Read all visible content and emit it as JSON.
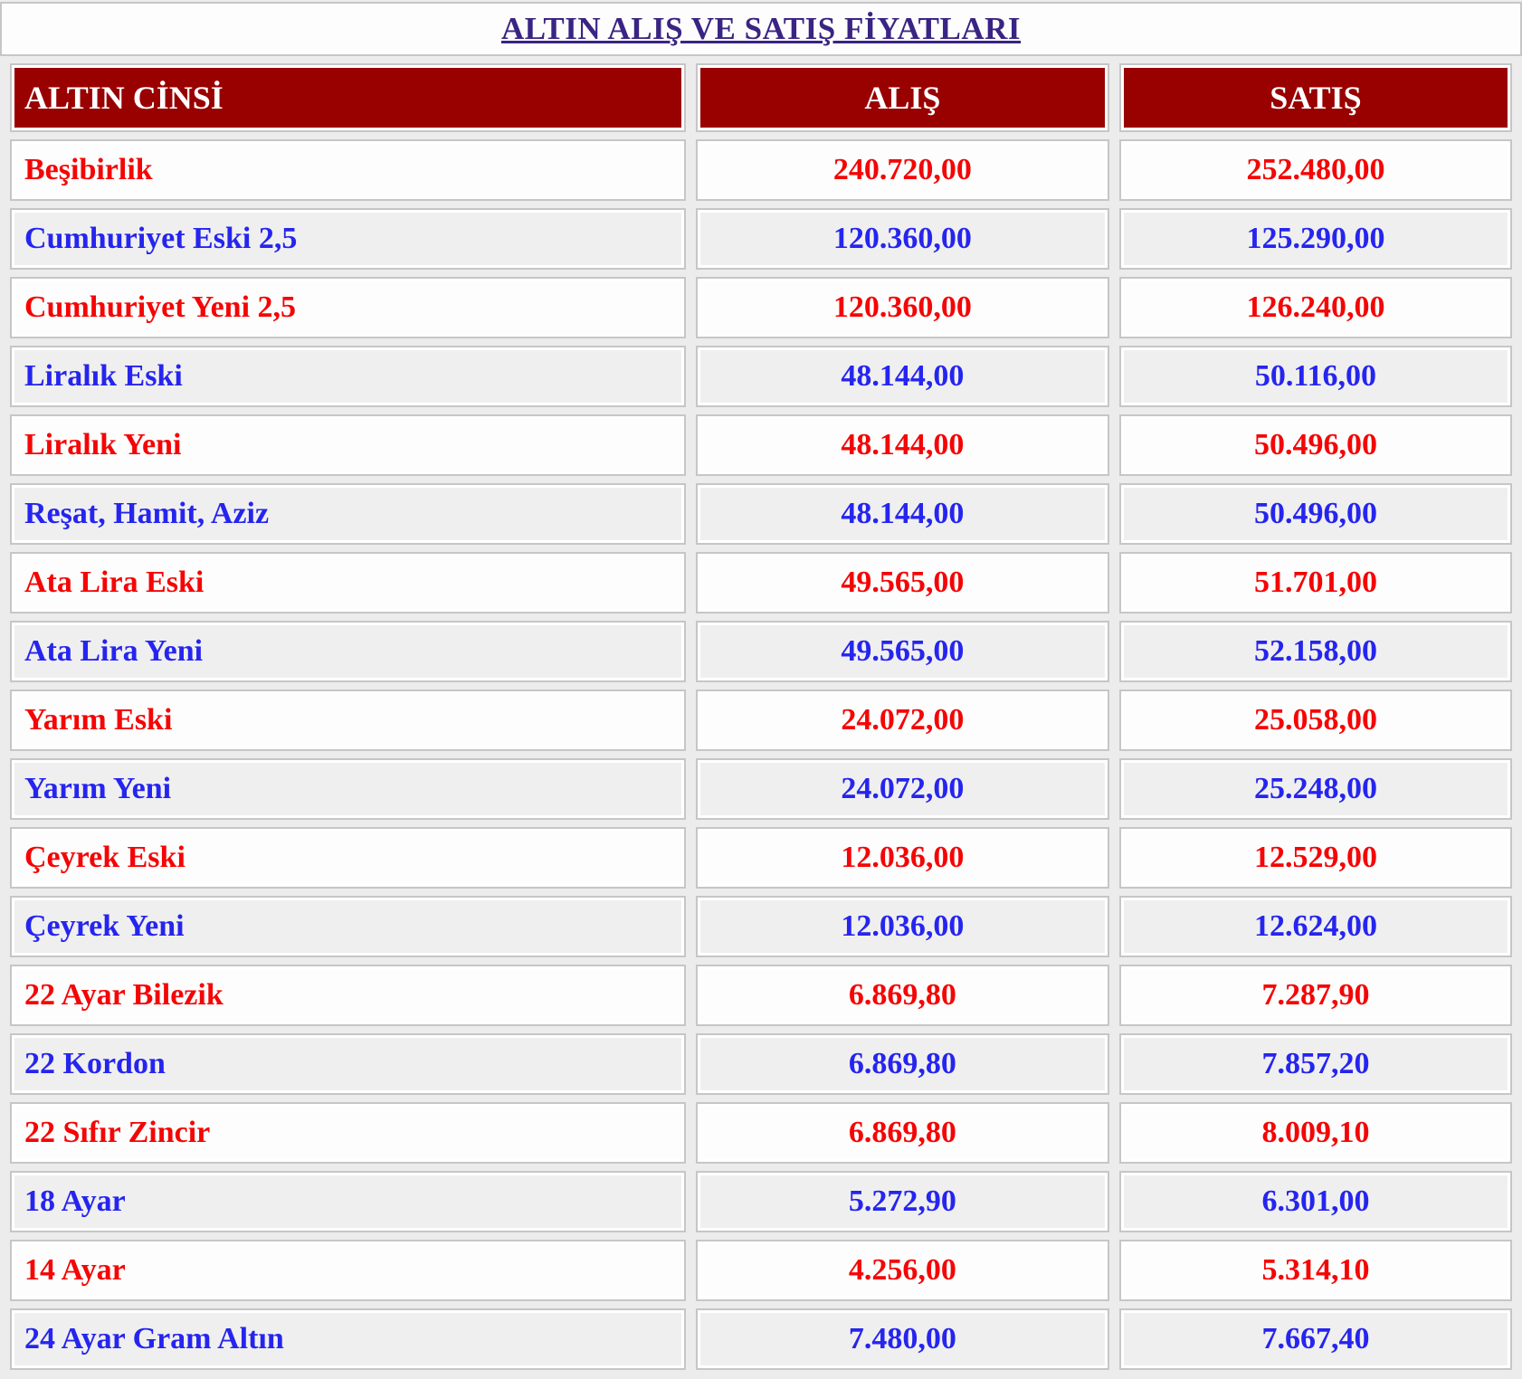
{
  "title": "ALTIN ALIŞ VE SATIŞ FİYATLARI",
  "table": {
    "headers": [
      "ALTIN CİNSİ",
      "ALIŞ",
      "SATIŞ"
    ],
    "rows": [
      {
        "name": "Beşibirlik",
        "buy": "240.720,00",
        "sell": "252.480,00",
        "color": "red"
      },
      {
        "name": "Cumhuriyet Eski 2,5",
        "buy": "120.360,00",
        "sell": "125.290,00",
        "color": "blue"
      },
      {
        "name": "Cumhuriyet Yeni 2,5",
        "buy": "120.360,00",
        "sell": "126.240,00",
        "color": "red"
      },
      {
        "name": "Liralık Eski",
        "buy": "48.144,00",
        "sell": "50.116,00",
        "color": "blue"
      },
      {
        "name": "Liralık Yeni",
        "buy": "48.144,00",
        "sell": "50.496,00",
        "color": "red"
      },
      {
        "name": "Reşat, Hamit, Aziz",
        "buy": "48.144,00",
        "sell": "50.496,00",
        "color": "blue"
      },
      {
        "name": "Ata Lira Eski",
        "buy": "49.565,00",
        "sell": "51.701,00",
        "color": "red"
      },
      {
        "name": "Ata Lira Yeni",
        "buy": "49.565,00",
        "sell": "52.158,00",
        "color": "blue"
      },
      {
        "name": "Yarım Eski",
        "buy": "24.072,00",
        "sell": "25.058,00",
        "color": "red"
      },
      {
        "name": "Yarım Yeni",
        "buy": "24.072,00",
        "sell": "25.248,00",
        "color": "blue"
      },
      {
        "name": "Çeyrek Eski",
        "buy": "12.036,00",
        "sell": "12.529,00",
        "color": "red"
      },
      {
        "name": "Çeyrek Yeni",
        "buy": "12.036,00",
        "sell": "12.624,00",
        "color": "blue"
      },
      {
        "name": "22 Ayar Bilezik",
        "buy": "6.869,80",
        "sell": "7.287,90",
        "color": "red"
      },
      {
        "name": "22 Kordon",
        "buy": "6.869,80",
        "sell": "7.857,20",
        "color": "blue"
      },
      {
        "name": "22 Sıfır Zincir",
        "buy": "6.869,80",
        "sell": "8.009,10",
        "color": "red"
      },
      {
        "name": "18 Ayar",
        "buy": "5.272,90",
        "sell": "6.301,00",
        "color": "blue"
      },
      {
        "name": "14 Ayar",
        "buy": "4.256,00",
        "sell": "5.314,10",
        "color": "red"
      },
      {
        "name": "24 Ayar Gram Altın",
        "buy": "7.480,00",
        "sell": "7.667,40",
        "color": "blue"
      }
    ]
  },
  "colors": {
    "header_bg": "#990000",
    "red_text": "#f50505",
    "blue_text": "#2525ef",
    "title_text": "#3a2483",
    "cell_border": "#c6c6c6",
    "row_white": "#fdfdfd",
    "row_gray": "#f0efef"
  }
}
